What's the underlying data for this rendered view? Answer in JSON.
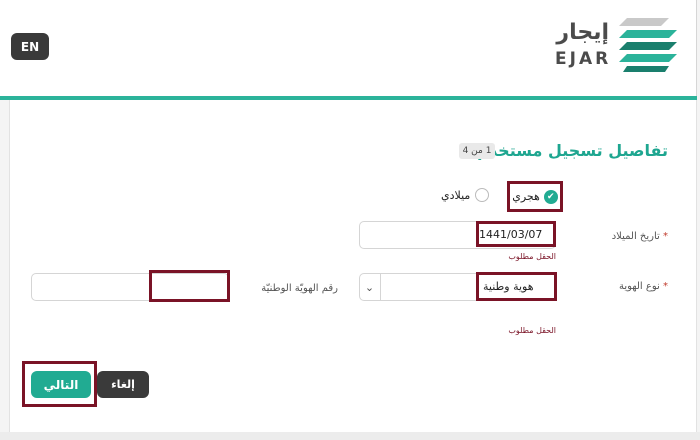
{
  "header": {
    "lang_button": "EN",
    "logo_ar": "إيجار",
    "logo_en": "EJAR"
  },
  "form": {
    "title": "تفاصيل تسجيل مستخدم",
    "step_badge": "1 من 4",
    "calendar": {
      "hijri_label": "هجري",
      "gregorian_label": "ميلادي",
      "selected": "هجري"
    },
    "dob": {
      "label": "تاريخ الميلاد",
      "required_mark": "*",
      "value": "1441/03/07",
      "error": "الحقل مطلوب"
    },
    "id_type": {
      "label": "نوع الهوية",
      "required_mark": "*",
      "value": "هوية وطنية",
      "error": "الحقل مطلوب"
    },
    "id_number": {
      "label": "رقم الهويّة الوطنيّة",
      "value": ""
    }
  },
  "actions": {
    "next_label": "التالي",
    "cancel_label": "إلغاء"
  },
  "colors": {
    "accent": "#21ab92",
    "highlight": "#7a1326",
    "dark_button": "#3a3a3a"
  },
  "icons": {
    "check": "check-icon",
    "chevron": "chevron-down-icon"
  }
}
